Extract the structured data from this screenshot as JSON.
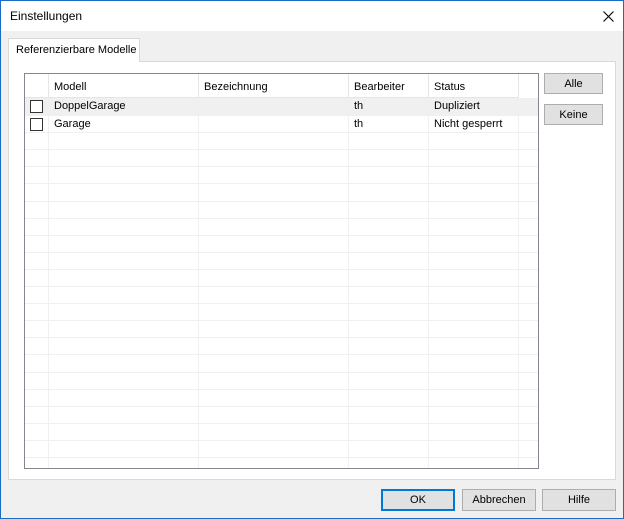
{
  "window": {
    "title": "Einstellungen"
  },
  "tabs": [
    {
      "label": "Referenzierbare Modelle"
    }
  ],
  "table": {
    "columns": [
      "",
      "Modell",
      "Bezeichnung",
      "Bearbeiter",
      "Status"
    ],
    "rows": [
      {
        "checked": false,
        "modell": "DoppelGarage",
        "bezeichnung": "",
        "bearbeiter": "th",
        "status": "Dupliziert"
      },
      {
        "checked": false,
        "modell": "Garage",
        "bezeichnung": "",
        "bearbeiter": "th",
        "status": "Nicht gesperrt"
      }
    ]
  },
  "side_buttons": {
    "all": "Alle",
    "none": "Keine"
  },
  "footer_buttons": {
    "ok": "OK",
    "cancel": "Abbrechen",
    "help": "Hilfe"
  },
  "icons": {
    "close": "close-icon"
  }
}
